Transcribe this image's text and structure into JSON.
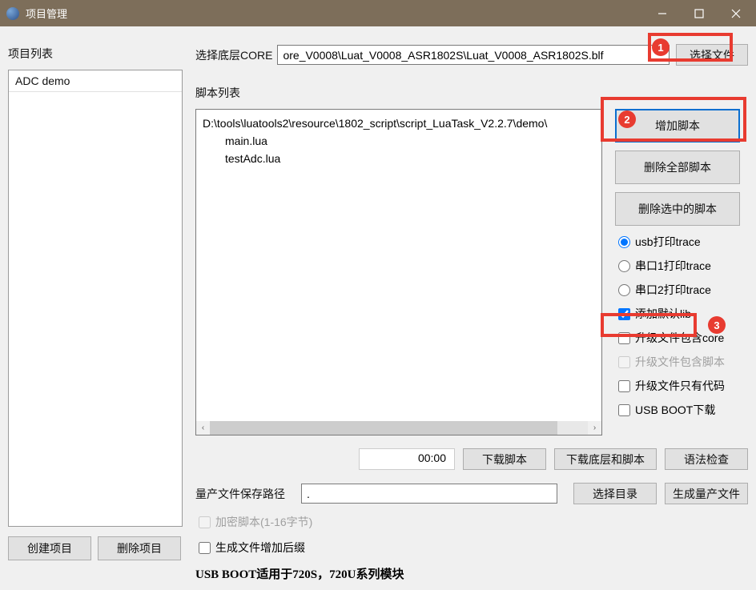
{
  "window": {
    "title": "项目管理"
  },
  "left": {
    "label": "项目列表",
    "items": [
      {
        "name": "ADC demo"
      }
    ],
    "create_btn": "创建项目",
    "delete_btn": "删除项目"
  },
  "core": {
    "label": "选择底层CORE",
    "value": "ore_V0008\\Luat_V0008_ASR1802S\\Luat_V0008_ASR1802S.blf",
    "pick_btn": "选择文件"
  },
  "scripts": {
    "label": "脚本列表",
    "root": "D:\\tools\\luatools2\\resource\\1802_script\\script_LuaTask_V2.2.7\\demo\\",
    "files": [
      "main.lua",
      "testAdc.lua"
    ]
  },
  "side": {
    "add_btn": "增加脚本",
    "del_all_btn": "删除全部脚本",
    "del_sel_btn": "删除选中的脚本",
    "radios": {
      "usb": "usb打印trace",
      "uart1": "串口1打印trace",
      "uart2": "串口2打印trace"
    },
    "checks": {
      "add_lib": "添加默认lib",
      "upgrade_core": "升级文件包含core",
      "upgrade_script": "升级文件包含脚本",
      "upgrade_code": "升级文件只有代码",
      "usb_boot": "USB BOOT下载"
    }
  },
  "bottom": {
    "time": "00:00",
    "dl_script": "下载脚本",
    "dl_core_script": "下载底层和脚本",
    "syntax_check": "语法检查",
    "mass_path_label": "量产文件保存路径",
    "mass_path_value": ".",
    "pick_dir": "选择目录",
    "gen_mass": "生成量产文件",
    "encrypt_label": "加密脚本(1-16字节)",
    "gen_suffix": "生成文件增加后缀",
    "footer_note": "USB BOOT适用于720S，720U系列模块"
  },
  "callouts": {
    "c1": "1",
    "c2": "2",
    "c3": "3"
  }
}
